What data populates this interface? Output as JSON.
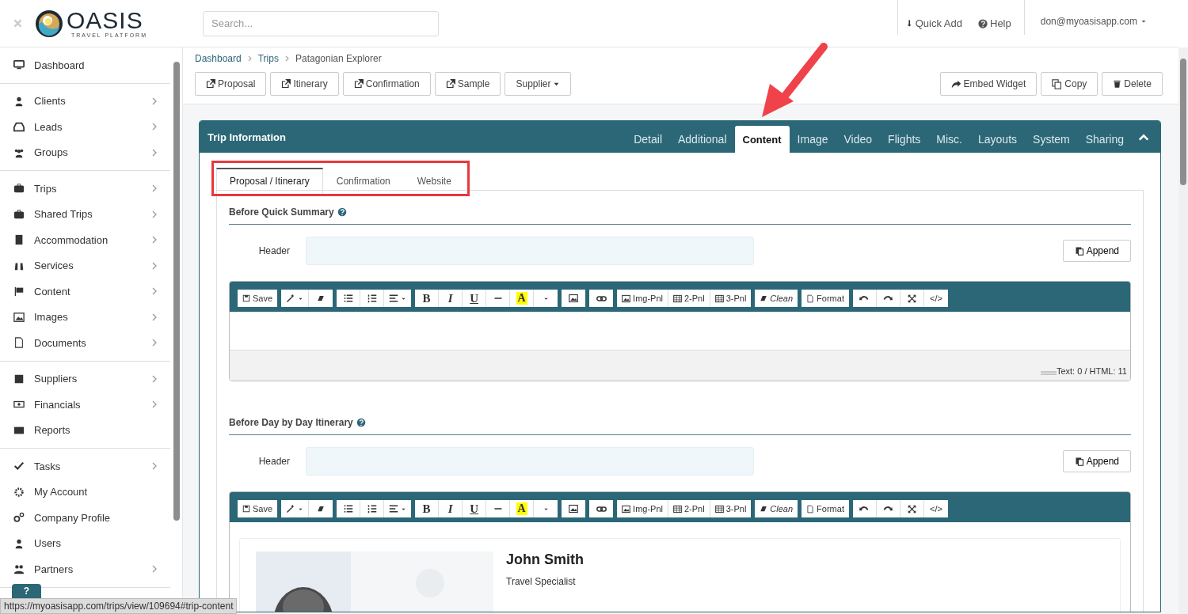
{
  "header": {
    "logo": {
      "name": "OASIS",
      "tagline": "TRAVEL PLATFORM"
    },
    "search": {
      "placeholder": "Search..."
    },
    "quick_add": "Quick Add",
    "help": "Help",
    "user": "don@myoasisapp.com"
  },
  "sidebar": {
    "sections": [
      [
        {
          "label": "Dashboard",
          "has_children": false
        }
      ],
      [
        {
          "label": "Clients",
          "has_children": true
        },
        {
          "label": "Leads",
          "has_children": true
        },
        {
          "label": "Groups",
          "has_children": true
        }
      ],
      [
        {
          "label": "Trips",
          "has_children": true
        },
        {
          "label": "Shared Trips",
          "has_children": true
        },
        {
          "label": "Accommodation",
          "has_children": true
        },
        {
          "label": "Services",
          "has_children": true
        },
        {
          "label": "Content",
          "has_children": true
        },
        {
          "label": "Images",
          "has_children": true
        },
        {
          "label": "Documents",
          "has_children": true
        }
      ],
      [
        {
          "label": "Suppliers",
          "has_children": true
        },
        {
          "label": "Financials",
          "has_children": true
        },
        {
          "label": "Reports",
          "has_children": false
        }
      ],
      [
        {
          "label": "Tasks",
          "has_children": true
        },
        {
          "label": "My Account",
          "has_children": false
        },
        {
          "label": "Company Profile",
          "has_children": false
        },
        {
          "label": "Users",
          "has_children": false
        },
        {
          "label": "Partners",
          "has_children": true
        }
      ]
    ]
  },
  "breadcrumb": [
    "Dashboard",
    "Trips",
    "Patagonian Explorer"
  ],
  "left_actions": [
    {
      "label": "Proposal",
      "kind": "external"
    },
    {
      "label": "Itinerary",
      "kind": "external"
    },
    {
      "label": "Confirmation",
      "kind": "external"
    },
    {
      "label": "Sample",
      "kind": "external"
    },
    {
      "label": "Supplier",
      "kind": "dropdown"
    }
  ],
  "right_actions": [
    {
      "label": "Embed Widget",
      "kind": "share"
    },
    {
      "label": "Copy",
      "kind": "copy"
    },
    {
      "label": "Delete",
      "kind": "trash"
    }
  ],
  "panel": {
    "title": "Trip Information",
    "tabs": [
      {
        "label": "Detail",
        "selected": false
      },
      {
        "label": "Additional",
        "selected": false
      },
      {
        "label": "Content",
        "selected": true
      },
      {
        "label": "Image",
        "selected": false
      },
      {
        "label": "Video",
        "selected": false
      },
      {
        "label": "Flights",
        "selected": false
      },
      {
        "label": "Misc.",
        "selected": false
      },
      {
        "label": "Layouts",
        "selected": false
      },
      {
        "label": "System",
        "selected": false
      },
      {
        "label": "Sharing",
        "selected": false
      }
    ],
    "subtabs": [
      {
        "label": "Proposal / Itinerary",
        "selected": true
      },
      {
        "label": "Confirmation",
        "selected": false
      },
      {
        "label": "Website",
        "selected": false
      }
    ],
    "sections": [
      {
        "title": "Before Quick Summary",
        "header_label": "Header",
        "append": "Append",
        "toolbar": {
          "save": "Save",
          "bold": "B",
          "italic": "I",
          "underline": "U",
          "highlight": "A",
          "img_pnl": "Img-Pnl",
          "two_pnl": "2-Pnl",
          "three_pnl": "3-Pnl",
          "clean": "Clean",
          "format": "Format",
          "code": "</>"
        },
        "status": "Text: 0 / HTML: 11"
      },
      {
        "title": "Before Day by Day Itinerary",
        "header_label": "Header",
        "append": "Append",
        "toolbar": {
          "save": "Save",
          "bold": "B",
          "italic": "I",
          "underline": "U",
          "highlight": "A",
          "img_pnl": "Img-Pnl",
          "two_pnl": "2-Pnl",
          "three_pnl": "3-Pnl",
          "clean": "Clean",
          "format": "Format",
          "code": "</>"
        },
        "card": {
          "name": "John Smith",
          "role": "Travel Specialist"
        }
      }
    ]
  },
  "status_url": "https://myoasisapp.com/trips/view/109694#trip-content",
  "help_button": "?"
}
